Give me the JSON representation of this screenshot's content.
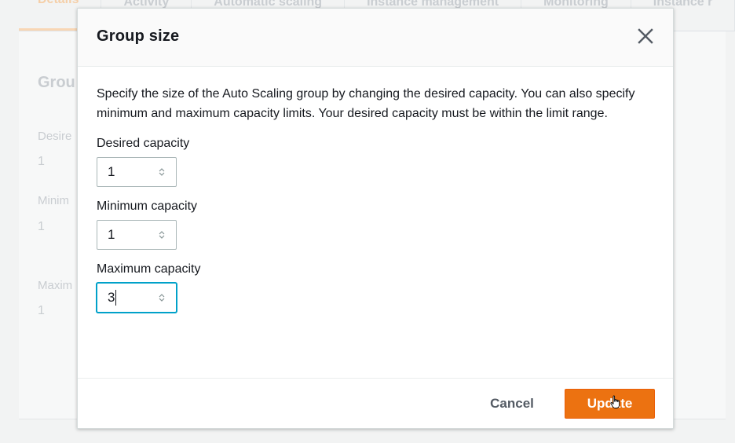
{
  "background": {
    "tabs": [
      "Details",
      "Activity",
      "Automatic scaling",
      "Instance management",
      "Monitoring",
      "Instance r"
    ],
    "section_heading": "Grou",
    "labels": [
      "Desire",
      "Minim",
      "Maxim"
    ],
    "values": [
      "1",
      "1",
      "1"
    ]
  },
  "modal": {
    "title": "Group size",
    "description": "Specify the size of the Auto Scaling group by changing the desired capacity. You can also specify minimum and maximum capacity limits. Your desired capacity must be within the limit range.",
    "fields": {
      "desired": {
        "label": "Desired capacity",
        "value": "1"
      },
      "minimum": {
        "label": "Minimum capacity",
        "value": "1"
      },
      "maximum": {
        "label": "Maximum capacity",
        "value": "3"
      }
    },
    "cancel_label": "Cancel",
    "update_label": "Update"
  },
  "colors": {
    "primary_button": "#ec7211",
    "focus_ring": "#00a1c9",
    "text": "#16191f",
    "muted_text": "#545b64"
  },
  "icons": {
    "close": "close-icon",
    "spinner": "spinner-icon",
    "cursor": "hand-cursor-icon"
  }
}
